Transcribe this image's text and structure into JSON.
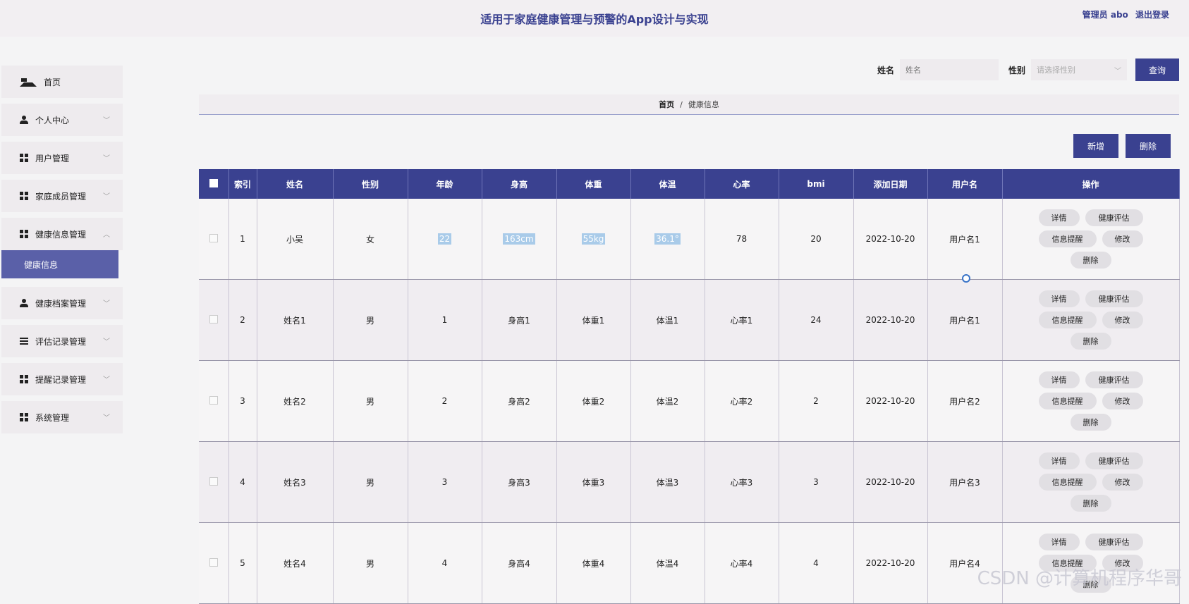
{
  "header": {
    "title": "适用于家庭健康管理与预警的App设计与实现",
    "admin_label": "管理员 abo",
    "logout_label": "退出登录"
  },
  "sidebar": {
    "items": [
      {
        "label": "首页",
        "icon": "home-icon"
      },
      {
        "label": "个人中心",
        "icon": "user-icon"
      },
      {
        "label": "用户管理",
        "icon": "grid-icon"
      },
      {
        "label": "家庭成员管理",
        "icon": "grid-icon"
      },
      {
        "label": "健康信息管理",
        "icon": "grid-icon"
      },
      {
        "label": "健康档案管理",
        "icon": "user-icon"
      },
      {
        "label": "评估记录管理",
        "icon": "list-icon"
      },
      {
        "label": "提醒记录管理",
        "icon": "grid-icon"
      },
      {
        "label": "系统管理",
        "icon": "grid-icon"
      }
    ],
    "submenu_active": "健康信息"
  },
  "search": {
    "name_label": "姓名",
    "name_placeholder": "姓名",
    "gender_label": "性别",
    "gender_placeholder": "请选择性别",
    "button_label": "查询"
  },
  "breadcrumb": {
    "home": "首页",
    "separator": "/",
    "current": "健康信息"
  },
  "actions": {
    "add_label": "新增",
    "delete_label": "删除"
  },
  "table": {
    "headers": [
      "索引",
      "姓名",
      "性别",
      "年龄",
      "身高",
      "体重",
      "体温",
      "心率",
      "bmi",
      "添加日期",
      "用户名",
      "操作"
    ],
    "rows": [
      {
        "index": "1",
        "name": "小吴",
        "gender": "女",
        "age": "22",
        "height": "163cm",
        "weight": "55kg",
        "temp": "36.1°",
        "heart": "78",
        "bmi": "20",
        "date": "2022-10-20",
        "user": "用户名1"
      },
      {
        "index": "2",
        "name": "姓名1",
        "gender": "男",
        "age": "1",
        "height": "身高1",
        "weight": "体重1",
        "temp": "体温1",
        "heart": "心率1",
        "bmi": "24",
        "date": "2022-10-20",
        "user": "用户名1"
      },
      {
        "index": "3",
        "name": "姓名2",
        "gender": "男",
        "age": "2",
        "height": "身高2",
        "weight": "体重2",
        "temp": "体温2",
        "heart": "心率2",
        "bmi": "2",
        "date": "2022-10-20",
        "user": "用户名2"
      },
      {
        "index": "4",
        "name": "姓名3",
        "gender": "男",
        "age": "3",
        "height": "身高3",
        "weight": "体重3",
        "temp": "体温3",
        "heart": "心率3",
        "bmi": "3",
        "date": "2022-10-20",
        "user": "用户名3"
      },
      {
        "index": "5",
        "name": "姓名4",
        "gender": "男",
        "age": "4",
        "height": "身高4",
        "weight": "体重4",
        "temp": "体温4",
        "heart": "心率4",
        "bmi": "4",
        "date": "2022-10-20",
        "user": "用户名4"
      }
    ],
    "row_ops": {
      "detail": "详情",
      "assess": "健康评估",
      "remind": "信息提醒",
      "edit": "修改",
      "delete": "删除"
    }
  },
  "watermark": "CSDN @计算机程序华哥",
  "colors": {
    "primary": "#3a4190",
    "submenu_active": "#5a60a8",
    "highlight": "#a9cbe9"
  }
}
